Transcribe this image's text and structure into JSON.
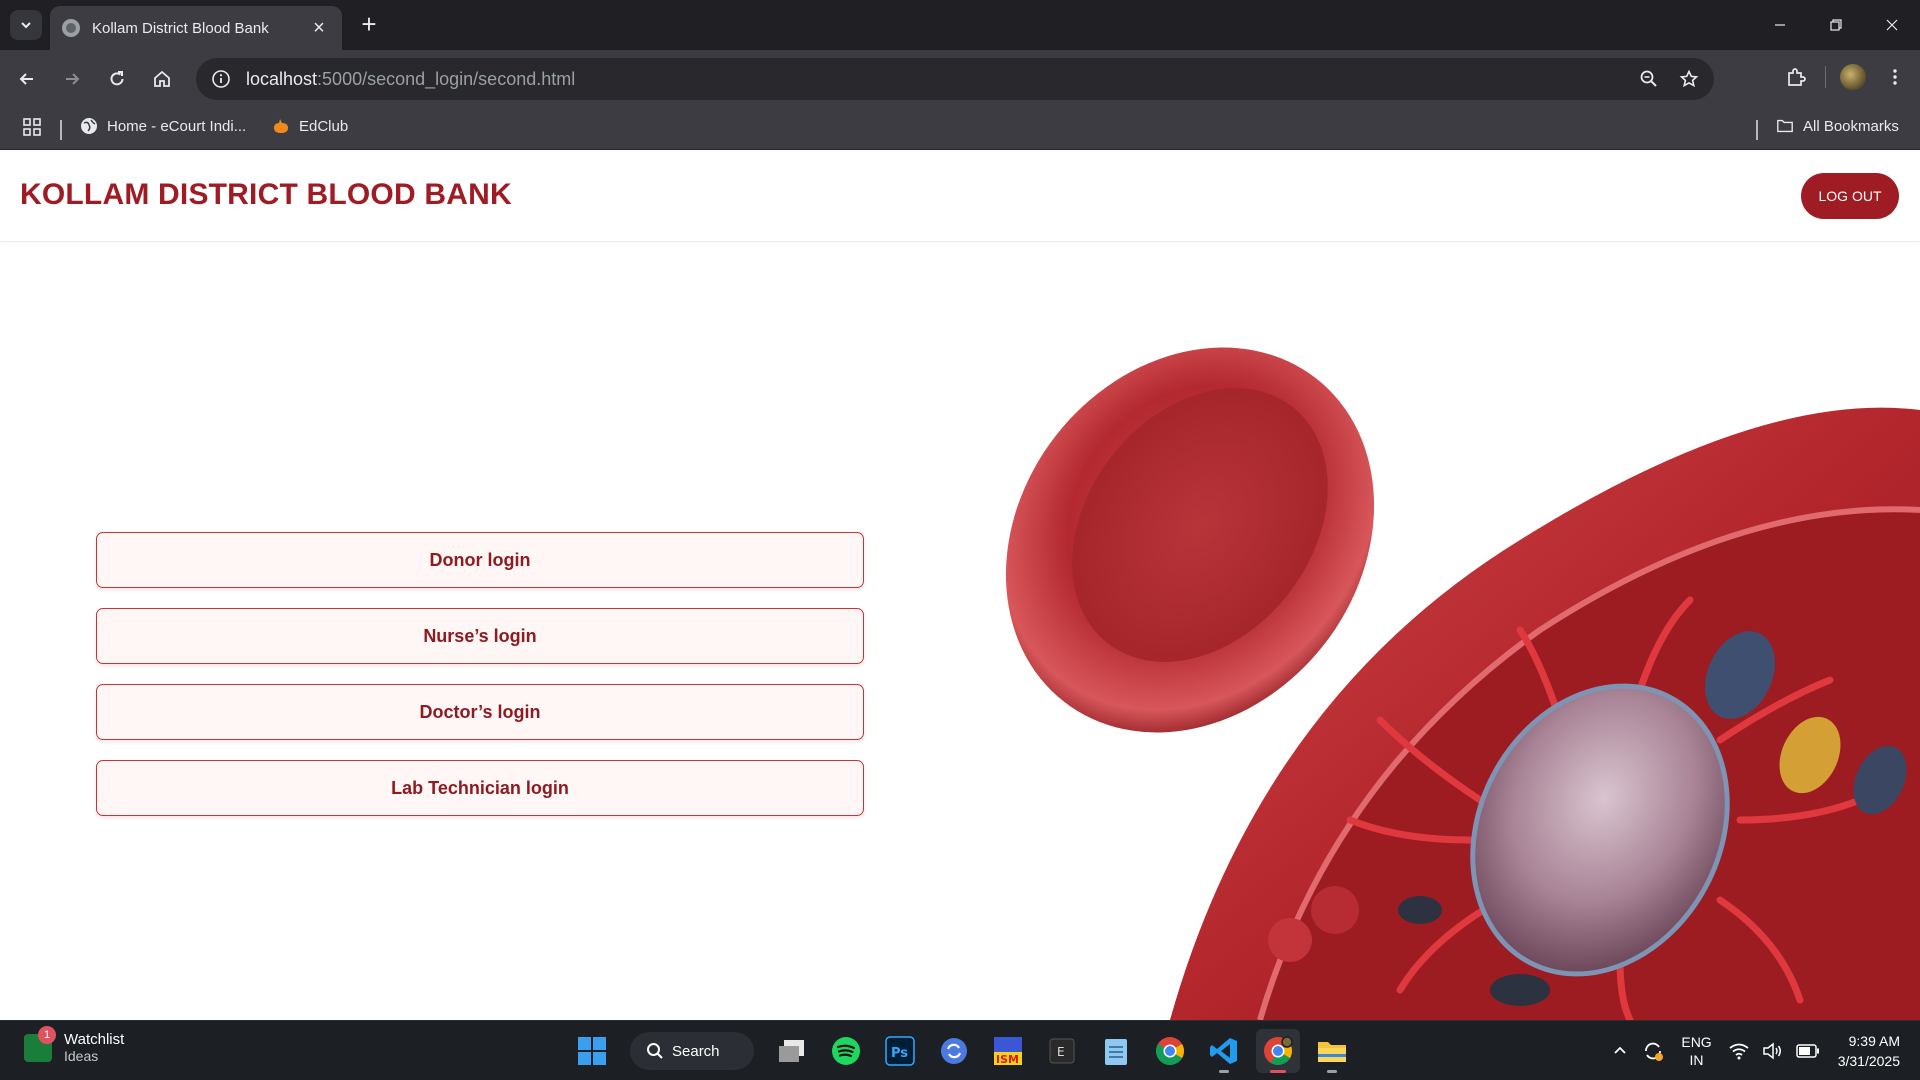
{
  "browser": {
    "tab_title": "Kollam District Blood Bank",
    "url_host": "localhost",
    "url_rest": ":5000/second_login/second.html",
    "bookmarks": [
      {
        "label": "Home - eCourt Indi..."
      },
      {
        "label": "EdClub"
      }
    ],
    "all_bookmarks": "All Bookmarks"
  },
  "header": {
    "brand": "KOLLAM DISTRICT BLOOD BANK",
    "logout_label": "LOG OUT"
  },
  "logins": [
    {
      "label": "Donor login"
    },
    {
      "label": "Nurse’s login"
    },
    {
      "label": "Doctor’s login"
    },
    {
      "label": "Lab Technician login"
    }
  ],
  "taskbar": {
    "widget_title": "Watchlist",
    "widget_sub": "Ideas",
    "widget_badge": "1",
    "search_label": "Search",
    "lang_top": "ENG",
    "lang_bottom": "IN",
    "time": "9:39 AM",
    "date": "3/31/2025"
  },
  "colors": {
    "brand": "#a01c24",
    "button_bg": "#fff6f6",
    "button_border": "#c8323a"
  }
}
